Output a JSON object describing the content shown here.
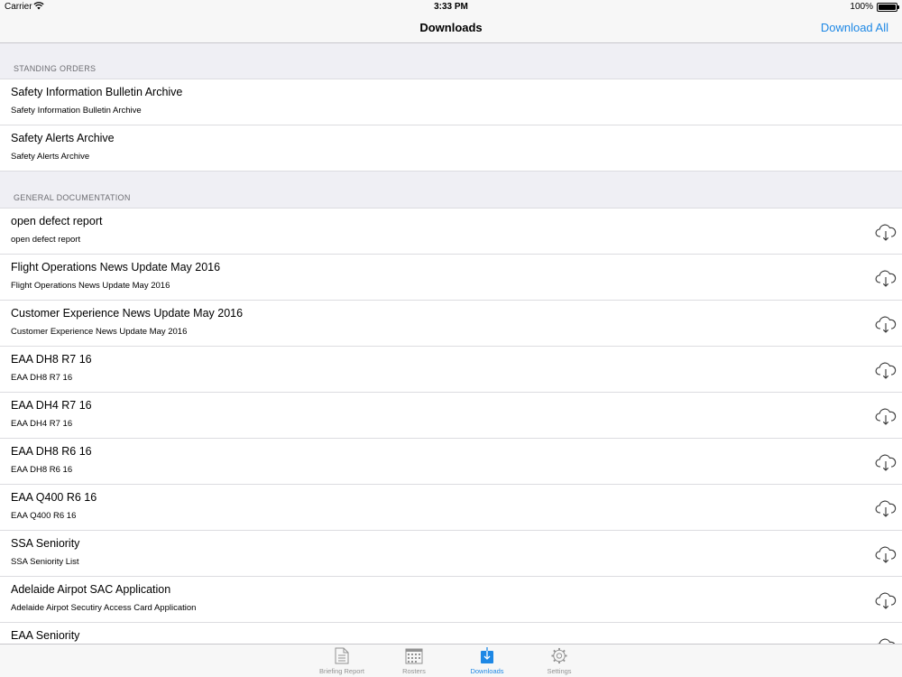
{
  "status": {
    "carrier": "Carrier",
    "time": "3:33 PM",
    "battery": "100%"
  },
  "nav": {
    "title": "Downloads",
    "download_all": "Download All"
  },
  "sections": [
    {
      "header": "STANDING ORDERS",
      "items": [
        {
          "title": "Safety Information Bulletin Archive",
          "subtitle": "Safety Information Bulletin Archive"
        },
        {
          "title": "Safety Alerts Archive",
          "subtitle": "Safety Alerts Archive"
        }
      ]
    },
    {
      "header": "GENERAL DOCUMENTATION",
      "items": [
        {
          "title": "open defect report",
          "subtitle": "open defect report"
        },
        {
          "title": "Flight Operations News Update May 2016",
          "subtitle": "Flight Operations News Update May 2016"
        },
        {
          "title": "Customer Experience News Update May 2016",
          "subtitle": "Customer Experience News Update May 2016"
        },
        {
          "title": "EAA DH8 R7 16",
          "subtitle": "EAA DH8 R7 16"
        },
        {
          "title": "EAA DH4 R7 16",
          "subtitle": "EAA DH4 R7 16"
        },
        {
          "title": "EAA DH8 R6 16",
          "subtitle": "EAA DH8 R6 16"
        },
        {
          "title": "EAA Q400 R6 16",
          "subtitle": "EAA Q400 R6 16"
        },
        {
          "title": "SSA Seniority",
          "subtitle": "SSA Seniority List"
        },
        {
          "title": "Adelaide Airpot SAC Application",
          "subtitle": "Adelaide Airpot Secutiry Access Card Application"
        },
        {
          "title": "EAA Seniority",
          "subtitle": ""
        }
      ]
    }
  ],
  "tabs": [
    {
      "label": "Briefing Report",
      "icon": "document-icon"
    },
    {
      "label": "Rosters",
      "icon": "calendar-icon"
    },
    {
      "label": "Downloads",
      "icon": "download-icon",
      "active": true
    },
    {
      "label": "Settings",
      "icon": "gear-icon"
    }
  ],
  "colors": {
    "accent": "#1e88e5",
    "section_bg": "#efeff4",
    "bar_bg": "#f7f7f7",
    "inactive_tab": "#929292"
  }
}
